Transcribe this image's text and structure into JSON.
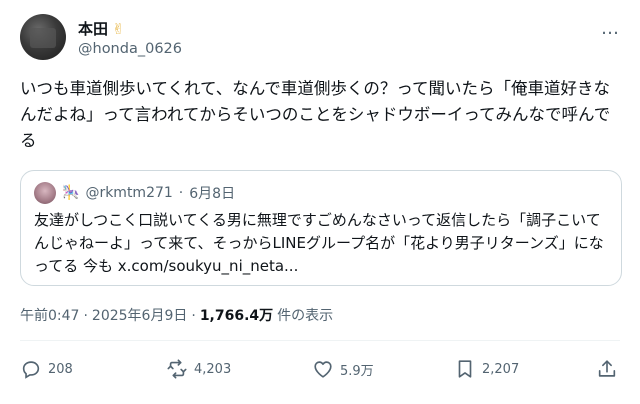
{
  "author": {
    "name": "本田",
    "emoji": "✌",
    "handle": "@honda_0626"
  },
  "more_icon": "…",
  "post_text": "いつも車道側歩いてくれて、なんで車道側歩くの？って聞いたら「俺車道好きなんだよね」って言われてからそいつのことをシャドウボーイってみんなで呼んでる",
  "quoted": {
    "emoji": "🎠",
    "handle": "@rkmtm271",
    "dot": "·",
    "date": "6月8日",
    "text": "友達がしつこく口説いてくる男に無理ですごめんなさいって返信したら「調子こいてんじゃねーよ」って来て、そっからLINEグループ名が「花より男子リターンズ」になってる 今も x.com/soukyu_ni_neta..."
  },
  "meta": {
    "time": "午前0:47",
    "sep1": "·",
    "date": "2025年6月9日",
    "sep2": "·",
    "views": "1,766.4万",
    "views_label": "件の表示"
  },
  "actions": {
    "replies": "208",
    "reposts": "4,203",
    "likes": "5.9万",
    "bookmarks": "2,207"
  },
  "colors": {
    "text": "#0f1419",
    "secondary": "#536471",
    "border": "#cfd9de"
  }
}
